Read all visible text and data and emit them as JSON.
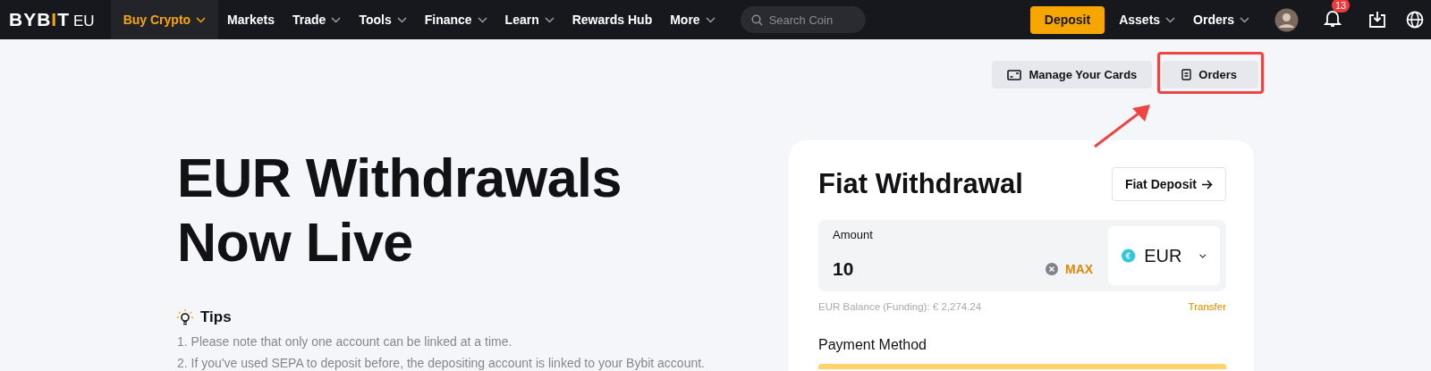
{
  "nav": {
    "logo": "BYBIT",
    "logo_suffix": "EU",
    "menu": [
      {
        "label": "Buy Crypto",
        "dropdown": true,
        "selected": true
      },
      {
        "label": "Markets",
        "dropdown": false,
        "selected": false
      },
      {
        "label": "Trade",
        "dropdown": true,
        "selected": false
      },
      {
        "label": "Tools",
        "dropdown": true,
        "selected": false
      },
      {
        "label": "Finance",
        "dropdown": true,
        "selected": false
      },
      {
        "label": "Learn",
        "dropdown": true,
        "selected": false
      },
      {
        "label": "Rewards Hub",
        "dropdown": false,
        "selected": false
      },
      {
        "label": "More",
        "dropdown": true,
        "selected": false
      }
    ],
    "search": {
      "placeholder": "Search Coin"
    },
    "deposit": "Deposit",
    "right_menu": [
      {
        "label": "Assets"
      },
      {
        "label": "Orders"
      }
    ],
    "notification_count": "13"
  },
  "actions": [
    {
      "label": "Manage Your Cards",
      "kind": "card",
      "highlighted": false
    },
    {
      "label": "Orders",
      "kind": "document",
      "highlighted": true
    }
  ],
  "hero": {
    "title_lines": [
      "EUR Withdrawals",
      "Now Live"
    ],
    "tips_title": "Tips",
    "tips": [
      "1. Please note that only one account can be linked at a time.",
      "2. If you've used SEPA to deposit before, the depositing account is linked to your Bybit account."
    ]
  },
  "card": {
    "title": "Fiat Withdrawal",
    "switch_button": "Fiat Deposit",
    "amount_label": "Amount",
    "amount_value": "10",
    "max": "MAX",
    "currency": "EUR",
    "balance": "EUR Balance (Funding): € 2,274.24",
    "transfer": "Transfer",
    "payment_label": "Payment Method"
  }
}
